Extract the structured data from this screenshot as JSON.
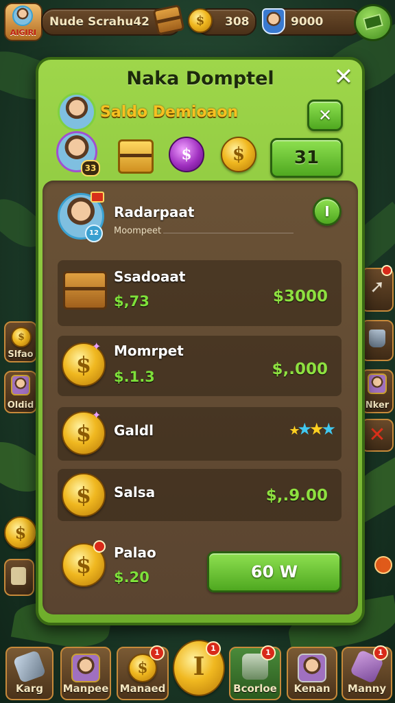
{
  "top_bar": {
    "player_badge": "AIGIRI",
    "player_name": "Nude Scrahu42",
    "coins": "308",
    "gems": "9000"
  },
  "modal": {
    "title": "Naka Domptel",
    "close_symbol": "✕",
    "subtitle": "Saldo Demioaon",
    "sub_close_symbol": "✕",
    "avatar_level": "33",
    "balance_button": "31",
    "profile": {
      "name": "Radarpaat",
      "detail": "Moompeet",
      "level_badge": "12",
      "toggle_symbol": "I"
    },
    "items": [
      {
        "name": "Ssadoaat",
        "price": "$,73",
        "amount": "$3000",
        "icon": "treasure-chest-icon"
      },
      {
        "name": "Momrpet",
        "price": "$.1.3",
        "amount": "$,.000",
        "icon": "gold-coin-icon"
      },
      {
        "name": "Galdl",
        "price": "",
        "amount": "",
        "icon": "gold-coin-icon"
      },
      {
        "name": "Salsa",
        "price": "",
        "amount": "$,.9.00",
        "icon": "gold-coin-icon"
      },
      {
        "name": "Palao",
        "price": "$.20",
        "amount": "",
        "icon": "gold-coin-icon"
      }
    ],
    "buy_button": "60 W"
  },
  "left_side": [
    {
      "label": "Slfao",
      "icon": "coin-pile-icon"
    },
    {
      "label": "Oldid",
      "icon": "character-icon"
    }
  ],
  "right_side": [
    {
      "label": "",
      "icon": "arrow-icon"
    },
    {
      "label": "",
      "icon": "bucket-icon"
    },
    {
      "label": "Nker",
      "icon": "character-icon"
    },
    {
      "label": "",
      "icon": "close-icon"
    }
  ],
  "bottom_nav": [
    {
      "label": "Karg",
      "icon": "sword-icon",
      "badge": ""
    },
    {
      "label": "Manpee",
      "icon": "character-icon",
      "badge": ""
    },
    {
      "label": "Manaed",
      "icon": "gold-coin-icon",
      "badge": "1"
    },
    {
      "label": "",
      "icon": "big-coin-icon",
      "badge": "1"
    },
    {
      "label": "Bcorloe",
      "icon": "chest-icon",
      "badge": "1"
    },
    {
      "label": "Kenan",
      "icon": "character-icon",
      "badge": ""
    },
    {
      "label": "Manny",
      "icon": "hammer-icon",
      "badge": "1"
    }
  ],
  "colors": {
    "modal_green": "#8fcc3e",
    "panel_brown": "#5f4833",
    "price_green": "#7ee03a",
    "gold": "#f0b820"
  }
}
